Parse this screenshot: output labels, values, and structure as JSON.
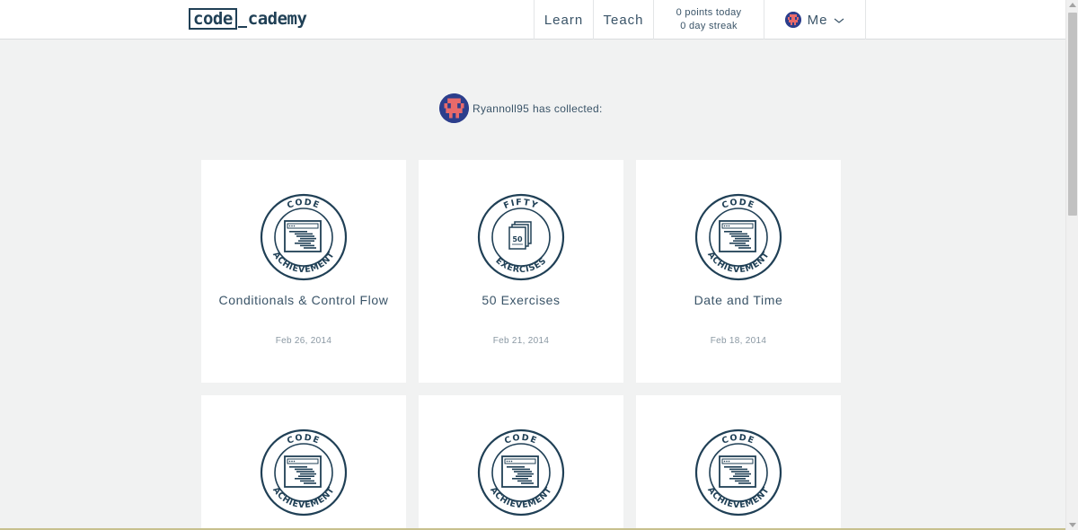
{
  "header": {
    "logo_boxed": "code",
    "logo_rest": "cademy",
    "nav_learn": "Learn",
    "nav_teach": "Teach",
    "points_today": "0 points today",
    "day_streak": "0 day streak",
    "me_label": "Me"
  },
  "collector": {
    "username": "Ryannoll95",
    "suffix": "has collected:"
  },
  "badges": [
    {
      "title": "Conditionals & Control Flow",
      "date": "Feb 26, 2014",
      "type": "code-achievement",
      "top_text": "CODE",
      "bottom_text": "ACHIEVEMENT"
    },
    {
      "title": "50 Exercises",
      "date": "Feb 21, 2014",
      "type": "fifty-exercises",
      "top_text": "FIFTY",
      "bottom_text": "EXERCISES",
      "count": "50"
    },
    {
      "title": "Date and Time",
      "date": "Feb 18, 2014",
      "type": "code-achievement",
      "top_text": "CODE",
      "bottom_text": "ACHIEVEMENT"
    },
    {
      "title": "",
      "date": "",
      "type": "code-achievement",
      "top_text": "CODE",
      "bottom_text": "ACHIEVEMENT"
    },
    {
      "title": "",
      "date": "",
      "type": "code-achievement",
      "top_text": "CODE",
      "bottom_text": "ACHIEVEMENT"
    },
    {
      "title": "",
      "date": "",
      "type": "code-achievement",
      "top_text": "CODE",
      "bottom_text": "ACHIEVEMENT"
    }
  ],
  "colors": {
    "badge_stroke": "#204056",
    "avatar_blue": "#2c3e8c",
    "avatar_pink": "#e86a6a",
    "background": "#f1f2f2"
  }
}
